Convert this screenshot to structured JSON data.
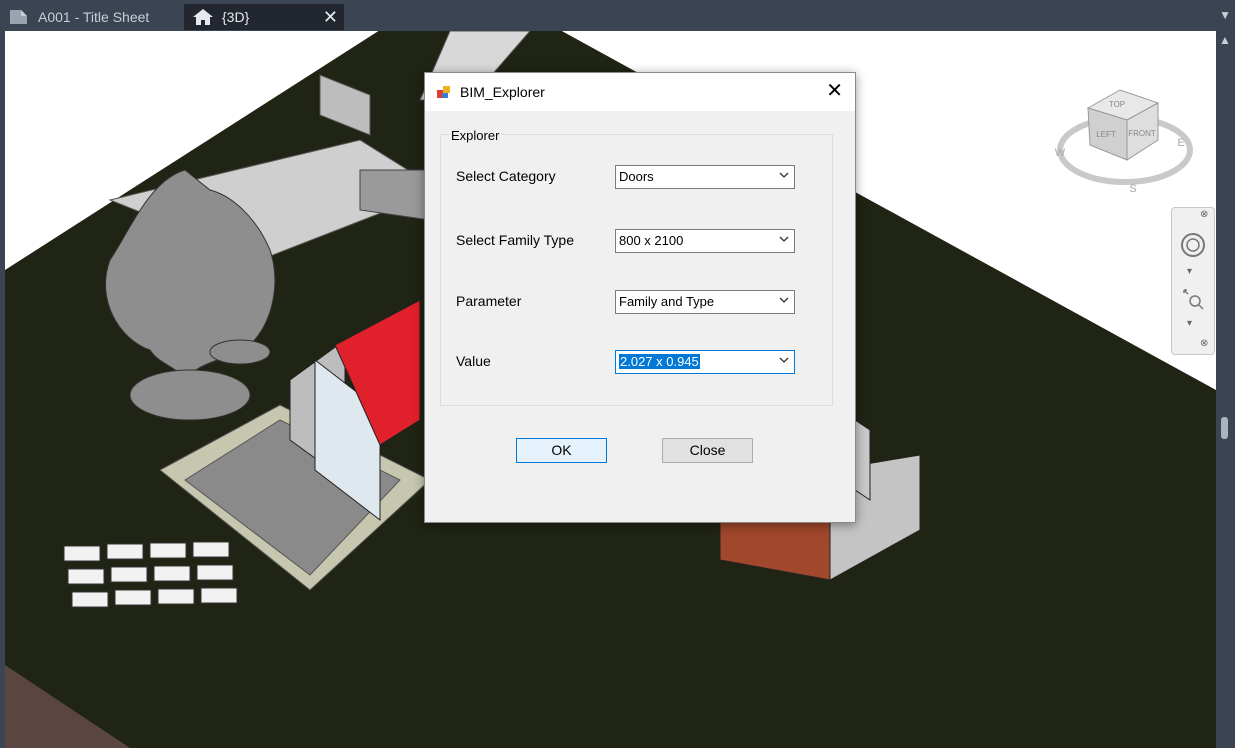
{
  "tabs": [
    {
      "label": "A001 - Title Sheet",
      "icon": "sheet-icon",
      "active": false
    },
    {
      "label": "{3D}",
      "icon": "home-3d-icon",
      "active": true
    }
  ],
  "viewcube": {
    "top": "TOP",
    "left": "LEFT",
    "front": "FRONT",
    "compass": [
      "W",
      "E",
      "S"
    ]
  },
  "dialog": {
    "title": "BIM_Explorer",
    "group_label": "Explorer",
    "fields": [
      {
        "label": "Select Category",
        "value": "Doors"
      },
      {
        "label": "Select Family Type",
        "value": "800 x 2100"
      },
      {
        "label": "Parameter",
        "value": "Family and Type"
      },
      {
        "label": "Value",
        "value": "2.027 x 0.945"
      }
    ],
    "ok_label": "OK",
    "close_label": "Close"
  },
  "colors": {
    "roof": "#e0202a",
    "terrain": "#1f2414",
    "chrome": "#3b4453"
  }
}
